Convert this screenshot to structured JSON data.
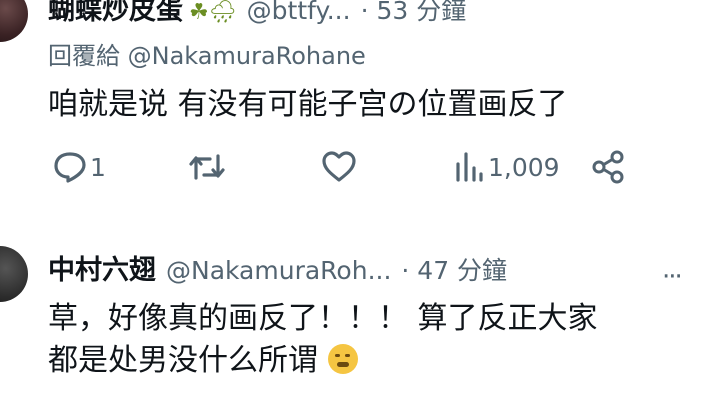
{
  "tweet1": {
    "name": "蝴蝶炒皮蛋",
    "handle": "@bttfy...",
    "time": "· 53 分鐘",
    "reply_prefix": "回覆給",
    "reply_mention": "@NakamuraRohane",
    "text": "咱就是说 有没有可能子宫の位置画反了",
    "actions": {
      "reply_count": "1",
      "retweet_count": "",
      "like_count": "",
      "views_count": "1,009"
    }
  },
  "tweet2": {
    "name": "中村六翅",
    "handle": "@NakamuraRoh...",
    "time": "· 47 分鐘",
    "more": "···",
    "text_line1": "草，好像真的画反了！！！ 算了反正大家",
    "text_line2": "都是处男没什么所谓"
  }
}
